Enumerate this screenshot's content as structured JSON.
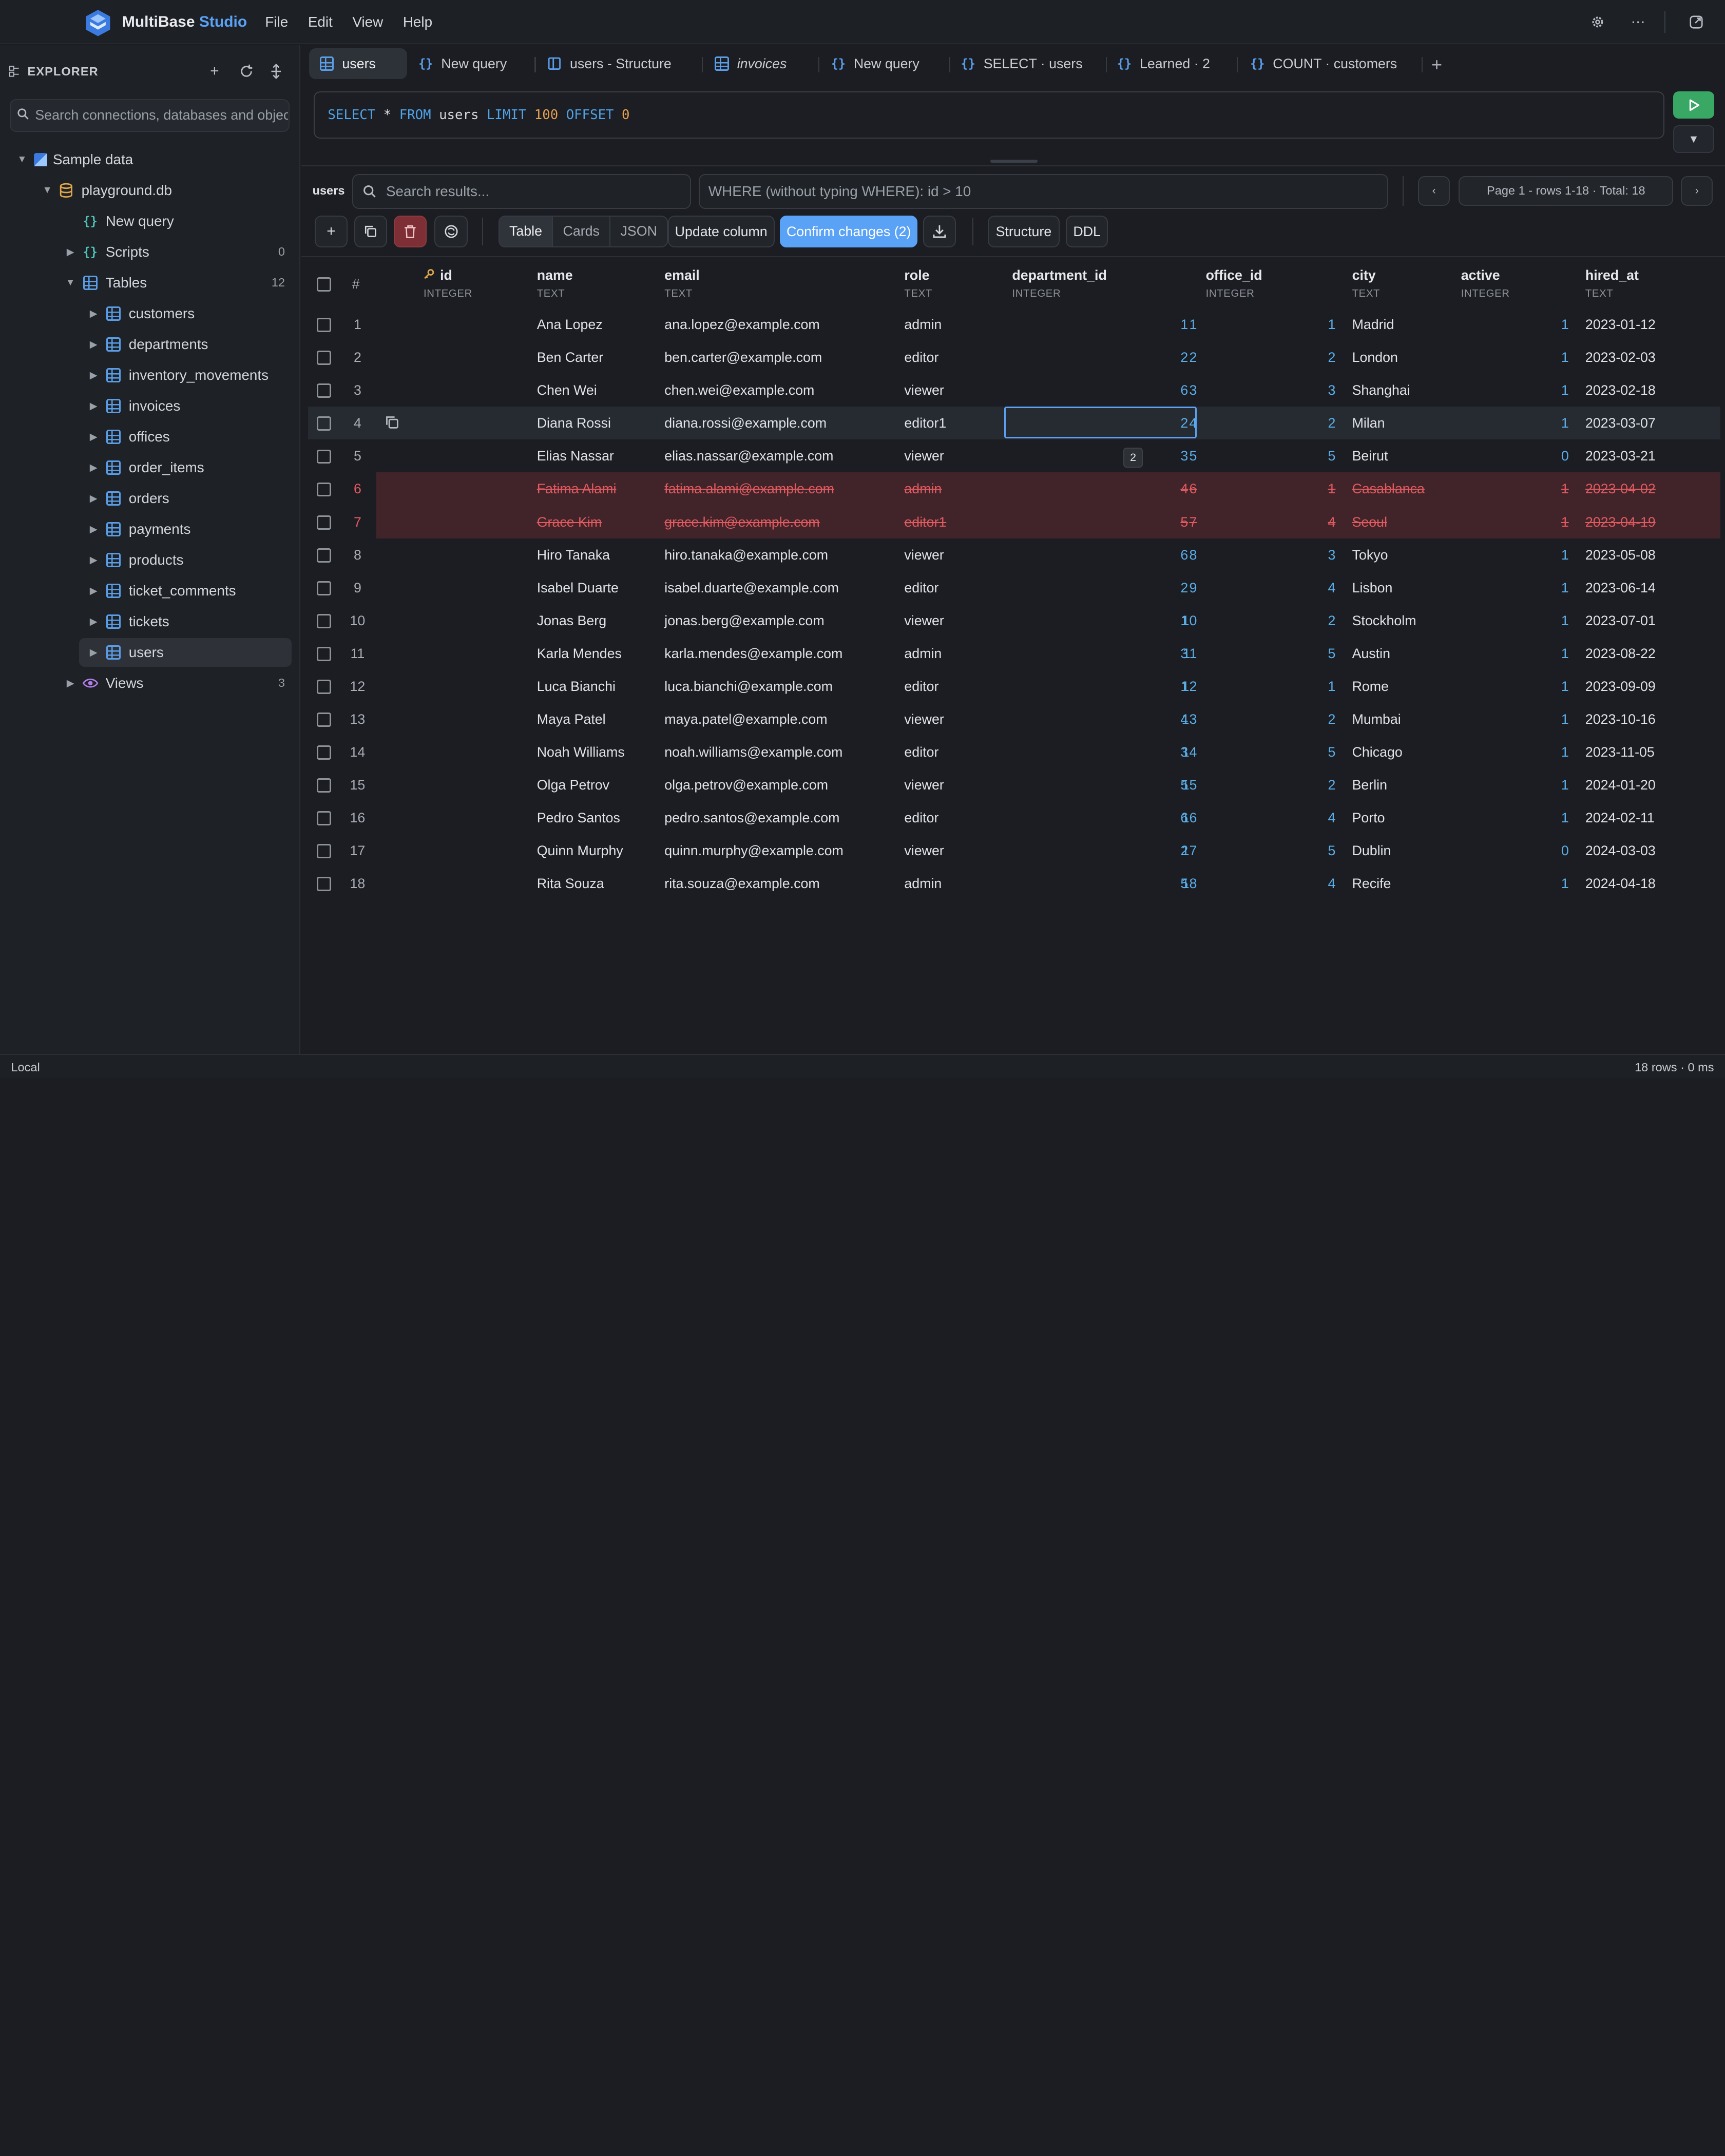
{
  "app": {
    "name_part1": "MultiBase",
    "name_part2": "Studio",
    "menu": [
      "File",
      "Edit",
      "View",
      "Help"
    ]
  },
  "sidebar": {
    "title": "EXPLORER",
    "search_placeholder": "Search connections, databases and objects",
    "connection": "Sample data",
    "database": "playground.db",
    "new_query": "New query",
    "scripts_label": "Scripts",
    "scripts_count": "0",
    "tables_label": "Tables",
    "tables_count": "12",
    "tables": [
      "customers",
      "departments",
      "inventory_movements",
      "invoices",
      "offices",
      "order_items",
      "orders",
      "payments",
      "products",
      "ticket_comments",
      "tickets",
      "users"
    ],
    "views_label": "Views",
    "views_count": "3"
  },
  "tabs": [
    {
      "label": "users",
      "icon": "table-icon"
    },
    {
      "label": "New query",
      "icon": "braces-icon"
    },
    {
      "label": "users - Structure",
      "icon": "structure-icon"
    },
    {
      "label": "invoices",
      "icon": "table-icon"
    },
    {
      "label": "New query",
      "icon": "braces-icon"
    },
    {
      "label": "SELECT · users",
      "icon": "braces-icon"
    },
    {
      "label": "Learned · 2",
      "icon": "braces-icon"
    },
    {
      "label": "COUNT · customers",
      "icon": "braces-icon"
    }
  ],
  "editor": {
    "tokens": [
      {
        "t": "SELECT",
        "k": "kw"
      },
      {
        "t": " * ",
        "k": "idf"
      },
      {
        "t": "FROM",
        "k": "kw"
      },
      {
        "t": " users ",
        "k": "idf"
      },
      {
        "t": "LIMIT",
        "k": "kw"
      },
      {
        "t": " 100 ",
        "k": "num"
      },
      {
        "t": "OFFSET",
        "k": "kw"
      },
      {
        "t": " 0",
        "k": "num"
      }
    ]
  },
  "results": {
    "label": "users",
    "search_placeholder": "Search results...",
    "where_placeholder": "WHERE (without typing WHERE): id > 10",
    "page_info": "Page 1 - rows 1-18 · Total: 18",
    "views": [
      "Table",
      "Cards",
      "JSON"
    ],
    "update_column": "Update column",
    "confirm_changes": "Confirm changes (2)",
    "structure": "Structure",
    "ddl": "DDL"
  },
  "table": {
    "rownum_header": "#",
    "columns": [
      {
        "name": "id",
        "type": "INTEGER"
      },
      {
        "name": "name",
        "type": "TEXT"
      },
      {
        "name": "email",
        "type": "TEXT"
      },
      {
        "name": "role",
        "type": "TEXT"
      },
      {
        "name": "department_id",
        "type": "INTEGER"
      },
      {
        "name": "office_id",
        "type": "INTEGER"
      },
      {
        "name": "city",
        "type": "TEXT"
      },
      {
        "name": "active",
        "type": "INTEGER"
      },
      {
        "name": "hired_at",
        "type": "TEXT"
      }
    ],
    "rows": [
      [
        "1",
        "1",
        "Ana Lopez",
        "ana.lopez@example.com",
        "admin",
        "1",
        "1",
        "Madrid",
        "1",
        "2023-01-12"
      ],
      [
        "2",
        "2",
        "Ben Carter",
        "ben.carter@example.com",
        "editor",
        "2",
        "2",
        "London",
        "1",
        "2023-02-03"
      ],
      [
        "3",
        "3",
        "Chen Wei",
        "chen.wei@example.com",
        "viewer",
        "6",
        "3",
        "Shanghai",
        "1",
        "2023-02-18"
      ],
      [
        "4",
        "4",
        "Diana Rossi",
        "diana.rossi@example.com",
        "editor1",
        "2",
        "2",
        "Milan",
        "1",
        "2023-03-07"
      ],
      [
        "5",
        "5",
        "Elias Nassar",
        "elias.nassar@example.com",
        "viewer",
        "3",
        "5",
        "Beirut",
        "0",
        "2023-03-21"
      ],
      [
        "6",
        "6",
        "Fatima Alami",
        "fatima.alami@example.com",
        "admin",
        "4",
        "1",
        "Casablanca",
        "1",
        "2023-04-02"
      ],
      [
        "7",
        "7",
        "Grace Kim",
        "grace.kim@example.com",
        "editor1",
        "5",
        "4",
        "Seoul",
        "1",
        "2023-04-19"
      ],
      [
        "8",
        "8",
        "Hiro Tanaka",
        "hiro.tanaka@example.com",
        "viewer",
        "6",
        "3",
        "Tokyo",
        "1",
        "2023-05-08"
      ],
      [
        "9",
        "9",
        "Isabel Duarte",
        "isabel.duarte@example.com",
        "editor",
        "2",
        "4",
        "Lisbon",
        "1",
        "2023-06-14"
      ],
      [
        "10",
        "10",
        "Jonas Berg",
        "jonas.berg@example.com",
        "viewer",
        "1",
        "2",
        "Stockholm",
        "1",
        "2023-07-01"
      ],
      [
        "11",
        "11",
        "Karla Mendes",
        "karla.mendes@example.com",
        "admin",
        "3",
        "5",
        "Austin",
        "1",
        "2023-08-22"
      ],
      [
        "12",
        "12",
        "Luca Bianchi",
        "luca.bianchi@example.com",
        "editor",
        "1",
        "1",
        "Rome",
        "1",
        "2023-09-09"
      ],
      [
        "13",
        "13",
        "Maya Patel",
        "maya.patel@example.com",
        "viewer",
        "4",
        "2",
        "Mumbai",
        "1",
        "2023-10-16"
      ],
      [
        "14",
        "14",
        "Noah Williams",
        "noah.williams@example.com",
        "editor",
        "3",
        "5",
        "Chicago",
        "1",
        "2023-11-05"
      ],
      [
        "15",
        "15",
        "Olga Petrov",
        "olga.petrov@example.com",
        "viewer",
        "5",
        "2",
        "Berlin",
        "1",
        "2024-01-20"
      ],
      [
        "16",
        "16",
        "Pedro Santos",
        "pedro.santos@example.com",
        "editor",
        "6",
        "4",
        "Porto",
        "1",
        "2024-02-11"
      ],
      [
        "17",
        "17",
        "Quinn Murphy",
        "quinn.murphy@example.com",
        "viewer",
        "2",
        "5",
        "Dublin",
        "0",
        "2024-03-03"
      ],
      [
        "18",
        "18",
        "Rita Souza",
        "rita.souza@example.com",
        "admin",
        "5",
        "4",
        "Recife",
        "1",
        "2024-04-18"
      ]
    ],
    "deleted_rows": [
      6,
      7
    ],
    "selected_row": 4,
    "editing_tooltip": "2"
  },
  "status": {
    "left": "Local",
    "right": "18 rows · 0 ms"
  }
}
